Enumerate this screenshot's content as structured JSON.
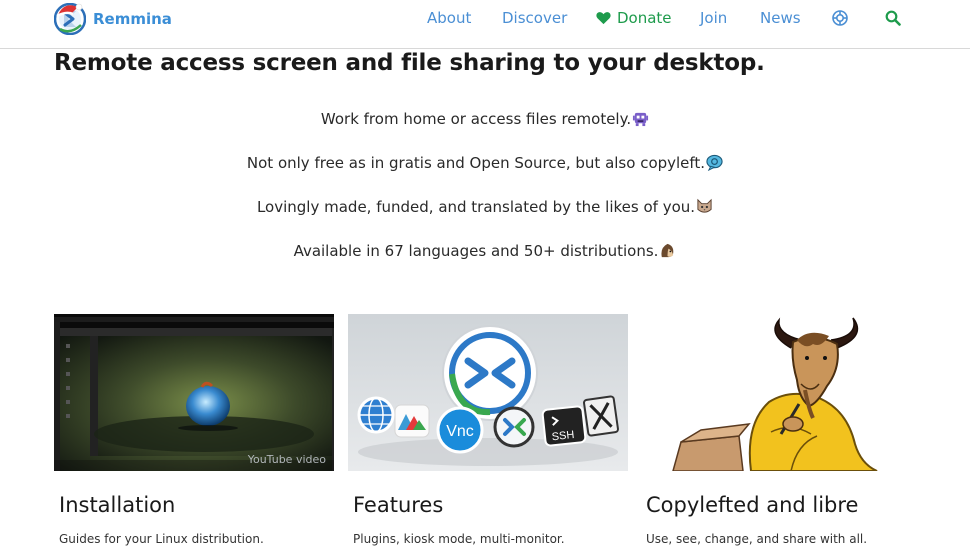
{
  "brand": {
    "name": "Remmina"
  },
  "nav": {
    "about": "About",
    "discover": "Discover",
    "donate": "Donate",
    "join": "Join",
    "news": "News"
  },
  "hero": {
    "title": "Remote access screen and file sharing to your desktop.",
    "taglines": [
      "Work from home or access files remotely.",
      "Not only free as in gratis and Open Source, but also copyleft.",
      "Lovingly made, funded, and translated by the likes of you.",
      "Available in 67 languages and 50+ distributions."
    ]
  },
  "cards": [
    {
      "title": "Installation",
      "desc": "Guides for your Linux distribution.",
      "overlay": "YouTube video"
    },
    {
      "title": "Features",
      "desc": "Plugins, kiosk mode, multi-monitor.",
      "overlay": ""
    },
    {
      "title": "Copylefted and libre",
      "desc": "Use, see, change, and share with all.",
      "overlay": ""
    }
  ],
  "icons": {
    "donate": "heart-icon",
    "matrix": "lifebuoy-icon",
    "search": "search-icon"
  },
  "colors": {
    "link": "#4b8fd4",
    "donate": "#1e9b4c",
    "brand": "#3b8ed6"
  }
}
